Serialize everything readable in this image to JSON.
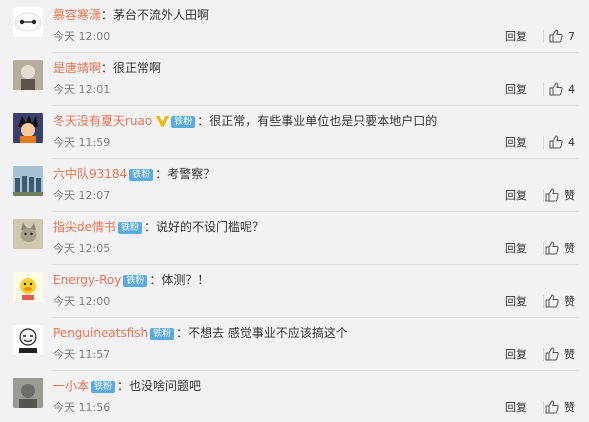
{
  "comments": [
    {
      "user": "慕容寒潇",
      "badge": "",
      "vip": false,
      "sep": "：",
      "text": "茅台不流外人田啊",
      "time": "今天 12:00",
      "reply": "回复",
      "likes": "7"
    },
    {
      "user": "是唐靖啊",
      "badge": "",
      "vip": false,
      "sep": "：",
      "text": "很正常啊",
      "time": "今天 12:01",
      "reply": "回复",
      "likes": "4"
    },
    {
      "user": "冬天没有夏天ruao",
      "badge": "铁粉",
      "vip": true,
      "sep": "：",
      "text": "很正常，有些事业单位也是只要本地户口的",
      "time": "今天 11:59",
      "reply": "回复",
      "likes": "4"
    },
    {
      "user": "六中队93184",
      "badge": "铁粉",
      "vip": false,
      "sep": "：",
      "text": "考警察？",
      "time": "今天 12:07",
      "reply": "回复",
      "likes": "赞"
    },
    {
      "user": "指尖de情书",
      "badge": "铁粉",
      "vip": false,
      "sep": "：",
      "text": "说好的不设门槛呢？",
      "time": "今天 12:05",
      "reply": "回复",
      "likes": "赞"
    },
    {
      "user": "Energy-Roy",
      "badge": "铁粉",
      "vip": false,
      "sep": "：",
      "text": "体测？！",
      "time": "今天 12:00",
      "reply": "回复",
      "likes": "赞"
    },
    {
      "user": "Penguineatsfish",
      "badge": "铁粉",
      "vip": false,
      "sep": "：",
      "text": "不想去 感觉事业不应该搞这个",
      "time": "今天 11:57",
      "reply": "回复",
      "likes": "赞"
    },
    {
      "user": "一小本",
      "badge": "铁粉",
      "vip": false,
      "sep": "：",
      "text": "也没啥问题吧",
      "time": "今天 11:56",
      "reply": "回复",
      "likes": "赞"
    }
  ],
  "avatars": [
    {
      "icon": "baymax-avatar",
      "bg": "#ffffff"
    },
    {
      "icon": "sketch-portrait-avatar",
      "bg": "#9a8f80"
    },
    {
      "icon": "cartoon-hero-avatar",
      "bg": "#2b2b2b"
    },
    {
      "icon": "group-photo-avatar",
      "bg": "#7fa0b8"
    },
    {
      "icon": "cat-avatar",
      "bg": "#c9c2a6"
    },
    {
      "icon": "cartoon-duck-avatar",
      "bg": "#fff7d6"
    },
    {
      "icon": "meme-face-avatar",
      "bg": "#ffffff"
    },
    {
      "icon": "gray-photo-avatar",
      "bg": "#8a8a82"
    }
  ],
  "colors": {
    "username": "#eb7350",
    "badge": "#5babe1",
    "vip": "#f7b500"
  }
}
